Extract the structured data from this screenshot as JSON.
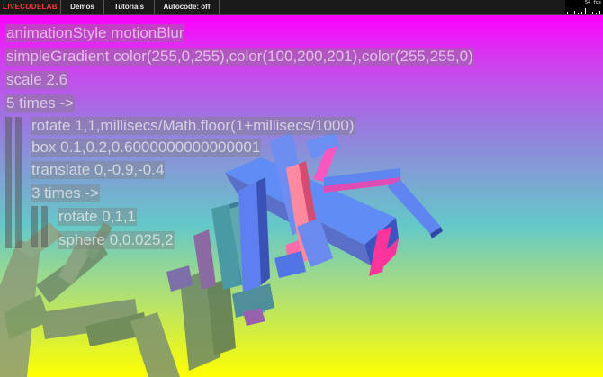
{
  "menu": {
    "logo": "LIVECODELAB",
    "demos": "Demos",
    "tutorials": "Tutorials",
    "autocode": "Autocode: off"
  },
  "fps": {
    "value": "54 fps"
  },
  "code": {
    "lines": [
      "animationStyle motionBlur",
      "simpleGradient color(255,0,255),color(100,200,201),color(255,255,0)",
      "scale 2.6",
      "5 times ->",
      "rotate 1,1,millisecs/Math.floor(1+millisecs/1000)",
      "box 0.1,0.2,0.6000000000000001",
      "translate 0,-0.9,-0.4",
      "3 times ->",
      "rotate 0,1,1",
      "sphere 0,0.025,2"
    ]
  },
  "colors": {
    "gradient_top": "#ff00ff",
    "gradient_mid": "#64c8c9",
    "gradient_bottom": "#ffff00",
    "box_face": "#5f8cf5",
    "box_side": "#3b55c0",
    "accent": "#ff3399"
  }
}
